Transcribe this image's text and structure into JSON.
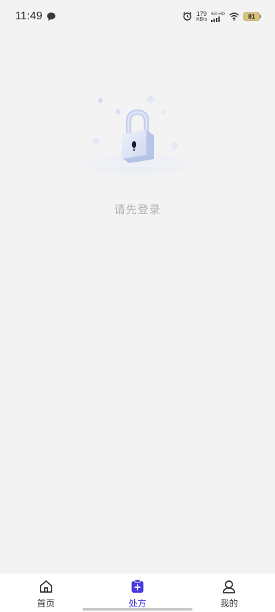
{
  "status_bar": {
    "time": "11:49",
    "net_speed_value": "179",
    "net_speed_unit": "KB/s",
    "network_label_top": "5G HD",
    "battery": "81"
  },
  "empty_state": {
    "message": "请先登录"
  },
  "bottom_nav": {
    "items": [
      {
        "label": "首页",
        "icon": "home-icon",
        "active": false
      },
      {
        "label": "处方",
        "icon": "prescription-icon",
        "active": true
      },
      {
        "label": "我的",
        "icon": "profile-icon",
        "active": false
      }
    ],
    "active_color": "#4a3be0"
  }
}
